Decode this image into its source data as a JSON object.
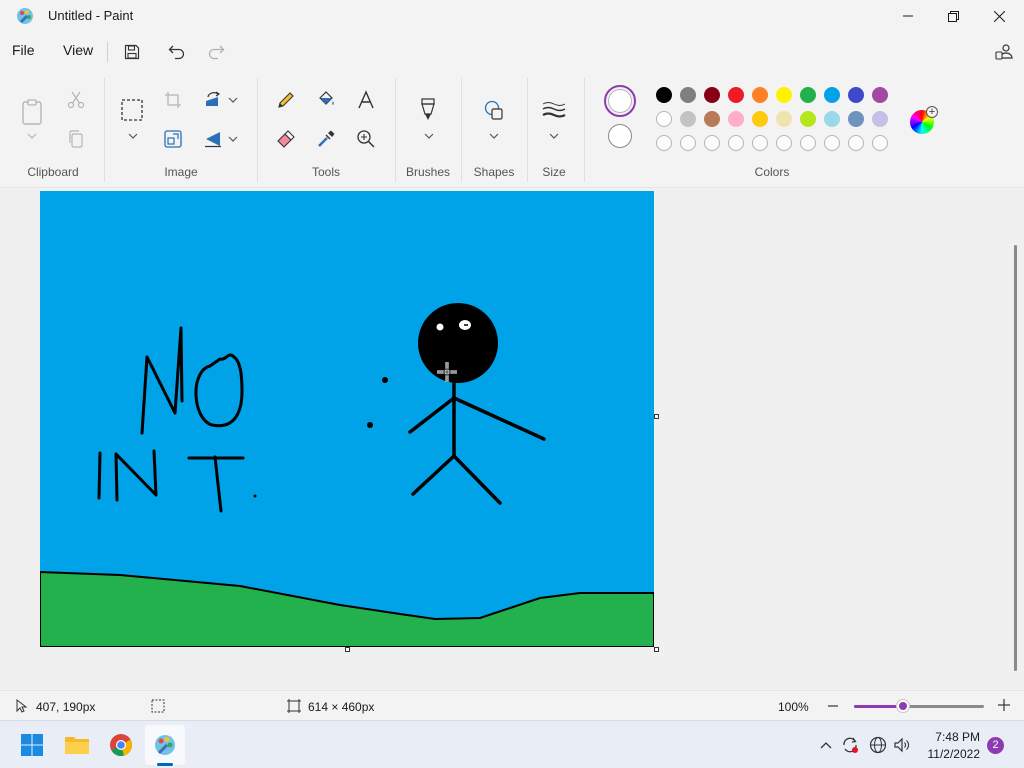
{
  "window": {
    "title": "Untitled - Paint"
  },
  "menu": {
    "file": "File",
    "view": "View"
  },
  "ribbon": {
    "groups": {
      "clipboard": "Clipboard",
      "image": "Image",
      "tools": "Tools",
      "brushes": "Brushes",
      "shapes": "Shapes",
      "size": "Size",
      "colors": "Colors"
    },
    "palette_row1": [
      "#000000",
      "#7f7f7f",
      "#880015",
      "#ed1c24",
      "#ff7f27",
      "#fff200",
      "#22b14c",
      "#00a2e8",
      "#3f48cc",
      "#a349a4"
    ],
    "palette_row2": [
      "#ffffff",
      "#c3c3c3",
      "#b97a57",
      "#ffaec9",
      "#ffc90e",
      "#efe4b0",
      "#b5e61d",
      "#99d9ea",
      "#7092be",
      "#c8bfe7"
    ],
    "palette_row3_empty_count": 10,
    "primary_color": "#ffffff",
    "secondary_color": "#ffffff",
    "accent": "#8e3ab2"
  },
  "canvas": {
    "background": "#00a2e8",
    "ground_color": "#22b14c",
    "stroke_color": "#000000",
    "drawn_text_line1": "NO",
    "drawn_text_line2": "IN T."
  },
  "status": {
    "cursor_position": "407, 190px",
    "canvas_size": "614 × 460px",
    "zoom": "100%",
    "zoom_level_fraction": 0.38
  },
  "taskbar": {
    "time": "7:48 PM",
    "date": "11/2/2022",
    "notification_count": "2",
    "apps": [
      "start-icon",
      "file-explorer-icon",
      "chrome-icon",
      "paint-icon"
    ]
  }
}
